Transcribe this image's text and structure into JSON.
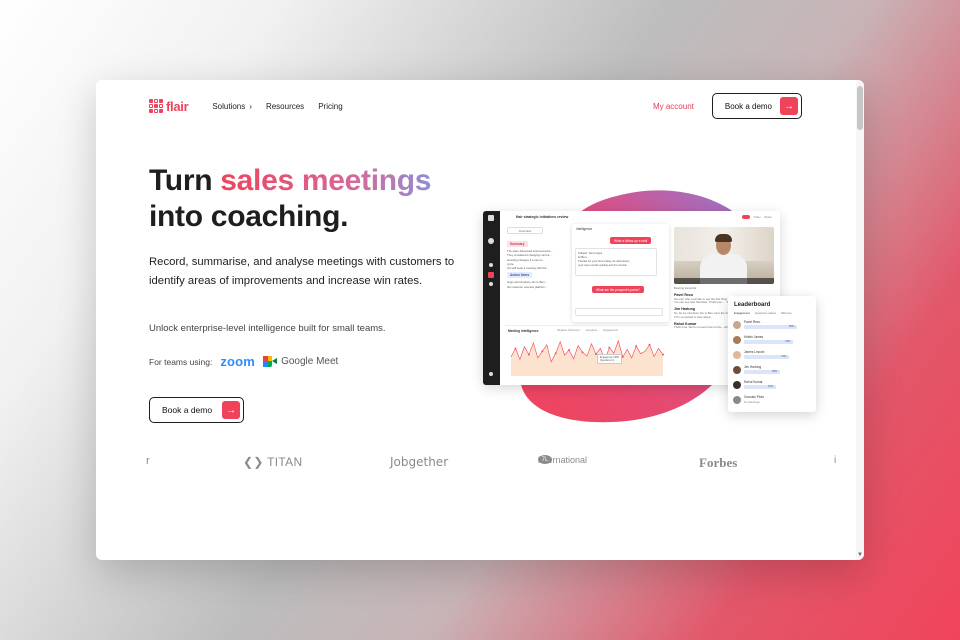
{
  "brand": {
    "name": "flair",
    "accent": "#f0435b",
    "dark": "#1e1e1e"
  },
  "nav": {
    "items": [
      {
        "label": "Solutions",
        "icon": "chevron-right-icon"
      },
      {
        "label": "Resources"
      },
      {
        "label": "Pricing"
      }
    ],
    "my_account": "My account",
    "cta": "Book a demo"
  },
  "hero": {
    "title_line1_plain": "Turn ",
    "title_line1_accent": "sales meetings",
    "title_line2": "into coaching.",
    "subtitle": "Record, summarise, and analyse  meetings with customers to identify areas of improvements and increase win rates.",
    "unlock": "Unlock enterprise-level intelligence built for small teams.",
    "teams_label": "For teams using:",
    "integrations": [
      "zoom",
      "Google Meet"
    ],
    "cta": "Book a demo"
  },
  "logos": [
    "r",
    "TITAN",
    "Jobgether",
    "international",
    "Forbes",
    "i"
  ],
  "logo_badge": "7L",
  "app": {
    "title": "flair strategic initiatives review",
    "toggle_labels": [
      "Video",
      "Share"
    ],
    "overview_tab": "Overview",
    "summary_tag": "Summary",
    "summary_lines": [
      "The team discussed improvements...",
      "They considered changing current...",
      "amazing changes if a user is...",
      "cycle.",
      "Jim will book a meeting with the..."
    ],
    "action_tag": "Action Items",
    "action_lines": [
      "Hugo will introduce Jim to Ben...",
      "the customer success platform..."
    ],
    "intelligence_label": "Intelligence",
    "pill_followup": "Write a follow-up e-mail",
    "email_lines": [
      "Subject: Next steps",
      "Hi Ben,",
      "Thanks for your time today. As discussed,",
      "your team works quickly and it's crucial..."
    ],
    "pill_pains": "What are the prospect's pains?",
    "transcript_label": "Meeting transcript",
    "transcript": [
      {
        "name": "Pavel Rezu",
        "text": "the user who most like to use the first thing that drew us to... they said it's great. You can see how Sensitive. Thank you. ... Sometimes throughout the day, if..."
      },
      {
        "name": "Jim Hartung",
        "text": "So, let me introduce Jim to Ben. He's the COO and he'll be able to see it... Sales if I'm so excited to hear about..."
      },
      {
        "name": "Rahul Kumar",
        "text": "That's true. We're not sure how to hire... where we're at now..."
      }
    ],
    "mi_title": "Meeting Intelligence",
    "mi_legend": [
      "Negative Sentiment",
      "Questions",
      "Engagement"
    ],
    "mi_tooltip": [
      "Engagement 48%",
      "Questions (1)"
    ],
    "chart_points": [
      40,
      58,
      35,
      62,
      45,
      70,
      38,
      52,
      66,
      30,
      48,
      72,
      44,
      55,
      36,
      64,
      50,
      42,
      68,
      46,
      58,
      34,
      60,
      48,
      74,
      40,
      56,
      38,
      63,
      47,
      52,
      66,
      41,
      58,
      45
    ]
  },
  "leaderboard": {
    "title": "Leaderboard",
    "tabs": [
      "Engagement",
      "Questions asked",
      "Talk time"
    ],
    "rows": [
      {
        "name": "Pavel Rezu",
        "value": "85%",
        "fraction": 0.85
      },
      {
        "name": "Kristin James",
        "value": "79%",
        "fraction": 0.79
      },
      {
        "name": "James Lincoln",
        "value": "73%",
        "fraction": 0.73
      },
      {
        "name": "Jim Hartung",
        "value": "58%",
        "fraction": 0.58
      },
      {
        "name": "Rahul Kumar",
        "value": "52%",
        "fraction": 0.52
      },
      {
        "name": "Gonzalo Pinto",
        "sub": "No Meetings"
      }
    ]
  }
}
